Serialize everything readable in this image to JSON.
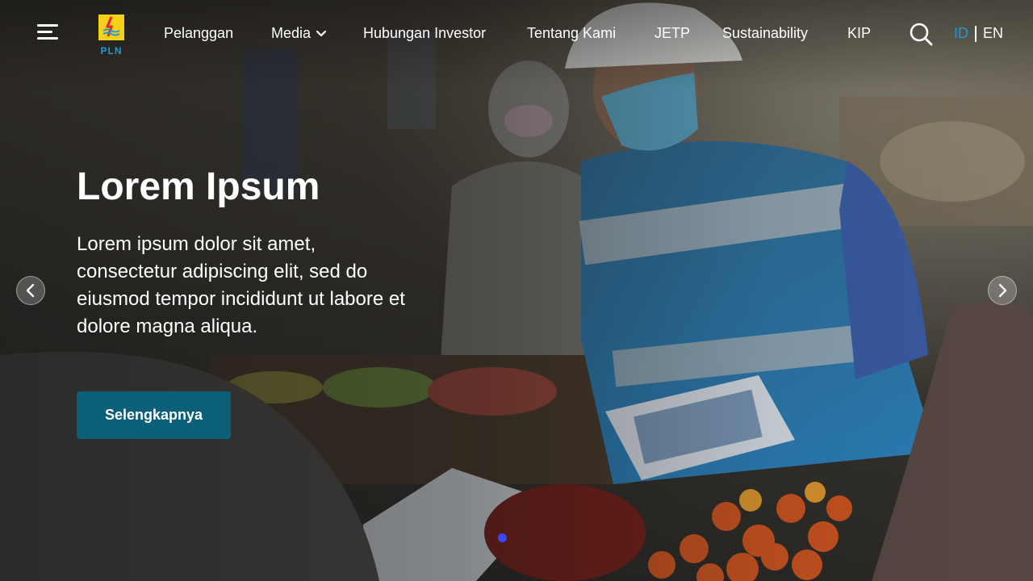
{
  "brand": {
    "logo_text": "PLN",
    "accent": "#1d9ad6",
    "logo_yellow": "#f7d117"
  },
  "nav": {
    "items": [
      {
        "label": "Pelanggan"
      },
      {
        "label": "Media"
      },
      {
        "label": "Hubungan Investor"
      },
      {
        "label": "Tentang Kami"
      },
      {
        "label": "JETP"
      },
      {
        "label": "Sustainability"
      },
      {
        "label": "KIP"
      }
    ],
    "dropdown_icon": "chevron-down-icon"
  },
  "header_icons": {
    "menu": "hamburger-menu-icon",
    "search": "search-icon"
  },
  "lang": {
    "active": "ID",
    "other": "EN"
  },
  "hero": {
    "title": "Lorem Ipsum",
    "description": "Lorem ipsum dolor sit amet, consectetur adipiscing elit, sed do eiusmod tempor incididunt ut labore et dolore magna aliqua.",
    "cta_label": "Selengkapnya",
    "cta_color": "#0c5f78"
  },
  "carousel": {
    "prev_icon": "chevron-left-icon",
    "next_icon": "chevron-right-icon",
    "indicator_color": "#3a46ff"
  }
}
